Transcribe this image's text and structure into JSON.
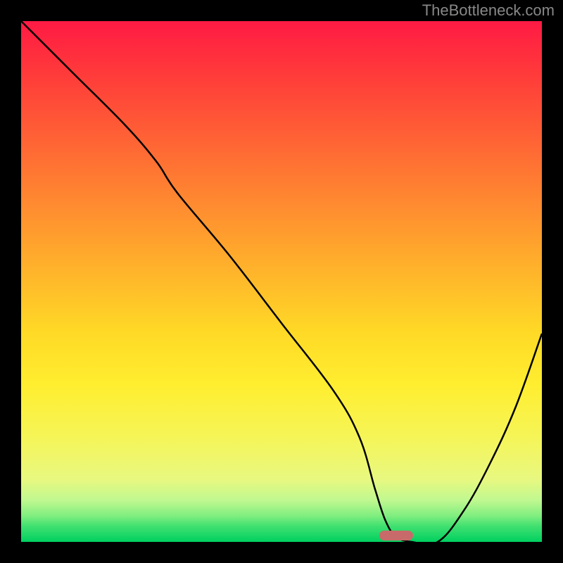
{
  "watermark": "TheBottleneck.com",
  "chart_data": {
    "type": "line",
    "title": "",
    "xlabel": "",
    "ylabel": "",
    "xlim": [
      0,
      100
    ],
    "ylim": [
      0,
      100
    ],
    "series": [
      {
        "name": "bottleneck-curve",
        "x": [
          0,
          10,
          20,
          26,
          30,
          40,
          50,
          60,
          65,
          68,
          70,
          72,
          75,
          80,
          85,
          90,
          95,
          100
        ],
        "values": [
          100,
          90,
          80,
          73,
          67,
          55,
          42,
          29,
          20,
          10,
          4,
          1,
          0,
          0,
          6,
          15,
          26,
          40
        ]
      }
    ],
    "marker": {
      "x_center": 72,
      "width_pct": 6.5
    },
    "gradient_colors": {
      "top": "#ff1a44",
      "mid": "#ffda26",
      "bottom": "#00d060"
    }
  }
}
